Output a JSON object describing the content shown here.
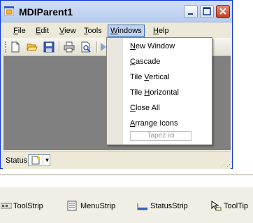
{
  "window": {
    "title": "MDIParent1"
  },
  "menubar": {
    "file": "ile",
    "file_mnemonic": "F",
    "edit": "dit",
    "edit_mnemonic": "E",
    "view": "iew",
    "view_mnemonic": "V",
    "tools": "ools",
    "tools_mnemonic": "T",
    "windows": "indows",
    "windows_mnemonic": "W",
    "help": "elp",
    "help_mnemonic": "H"
  },
  "windows_menu": {
    "items": [
      {
        "mnemonic": "N",
        "rest": "ew Window"
      },
      {
        "mnemonic": "C",
        "rest": "ascade"
      },
      {
        "pre": "Tile ",
        "mnemonic": "V",
        "rest": "ertical"
      },
      {
        "pre": "Tile ",
        "mnemonic": "H",
        "rest": "orizontal"
      },
      {
        "mnemonic": "C",
        "rest": "lose All"
      },
      {
        "mnemonic": "A",
        "rest": "rrange Icons"
      }
    ],
    "placeholder": "Tapez ici"
  },
  "statusbar": {
    "label": "Status"
  },
  "toolbox": {
    "items": [
      "ToolStrip",
      "MenuStrip",
      "StatusStrip",
      "ToolTip"
    ]
  },
  "colors": {
    "client_area": "#808080",
    "title_border": "#0831d9",
    "menu_highlight": "#c1d2ee"
  }
}
